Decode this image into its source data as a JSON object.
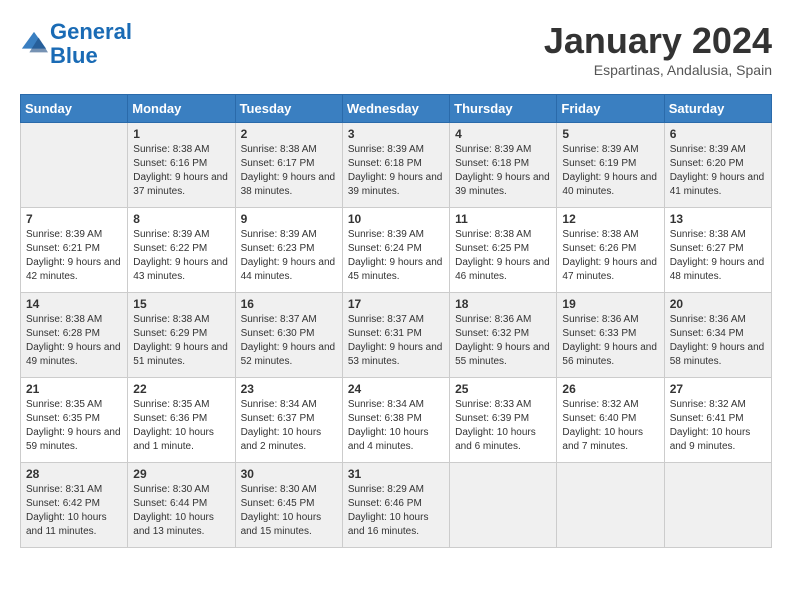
{
  "header": {
    "logo_line1": "General",
    "logo_line2": "Blue",
    "month_title": "January 2024",
    "subtitle": "Espartinas, Andalusia, Spain"
  },
  "days_of_week": [
    "Sunday",
    "Monday",
    "Tuesday",
    "Wednesday",
    "Thursday",
    "Friday",
    "Saturday"
  ],
  "weeks": [
    [
      {
        "day": "",
        "sunrise": "",
        "sunset": "",
        "daylight": ""
      },
      {
        "day": "1",
        "sunrise": "Sunrise: 8:38 AM",
        "sunset": "Sunset: 6:16 PM",
        "daylight": "Daylight: 9 hours and 37 minutes."
      },
      {
        "day": "2",
        "sunrise": "Sunrise: 8:38 AM",
        "sunset": "Sunset: 6:17 PM",
        "daylight": "Daylight: 9 hours and 38 minutes."
      },
      {
        "day": "3",
        "sunrise": "Sunrise: 8:39 AM",
        "sunset": "Sunset: 6:18 PM",
        "daylight": "Daylight: 9 hours and 39 minutes."
      },
      {
        "day": "4",
        "sunrise": "Sunrise: 8:39 AM",
        "sunset": "Sunset: 6:18 PM",
        "daylight": "Daylight: 9 hours and 39 minutes."
      },
      {
        "day": "5",
        "sunrise": "Sunrise: 8:39 AM",
        "sunset": "Sunset: 6:19 PM",
        "daylight": "Daylight: 9 hours and 40 minutes."
      },
      {
        "day": "6",
        "sunrise": "Sunrise: 8:39 AM",
        "sunset": "Sunset: 6:20 PM",
        "daylight": "Daylight: 9 hours and 41 minutes."
      }
    ],
    [
      {
        "day": "7",
        "sunrise": "Sunrise: 8:39 AM",
        "sunset": "Sunset: 6:21 PM",
        "daylight": "Daylight: 9 hours and 42 minutes."
      },
      {
        "day": "8",
        "sunrise": "Sunrise: 8:39 AM",
        "sunset": "Sunset: 6:22 PM",
        "daylight": "Daylight: 9 hours and 43 minutes."
      },
      {
        "day": "9",
        "sunrise": "Sunrise: 8:39 AM",
        "sunset": "Sunset: 6:23 PM",
        "daylight": "Daylight: 9 hours and 44 minutes."
      },
      {
        "day": "10",
        "sunrise": "Sunrise: 8:39 AM",
        "sunset": "Sunset: 6:24 PM",
        "daylight": "Daylight: 9 hours and 45 minutes."
      },
      {
        "day": "11",
        "sunrise": "Sunrise: 8:38 AM",
        "sunset": "Sunset: 6:25 PM",
        "daylight": "Daylight: 9 hours and 46 minutes."
      },
      {
        "day": "12",
        "sunrise": "Sunrise: 8:38 AM",
        "sunset": "Sunset: 6:26 PM",
        "daylight": "Daylight: 9 hours and 47 minutes."
      },
      {
        "day": "13",
        "sunrise": "Sunrise: 8:38 AM",
        "sunset": "Sunset: 6:27 PM",
        "daylight": "Daylight: 9 hours and 48 minutes."
      }
    ],
    [
      {
        "day": "14",
        "sunrise": "Sunrise: 8:38 AM",
        "sunset": "Sunset: 6:28 PM",
        "daylight": "Daylight: 9 hours and 49 minutes."
      },
      {
        "day": "15",
        "sunrise": "Sunrise: 8:38 AM",
        "sunset": "Sunset: 6:29 PM",
        "daylight": "Daylight: 9 hours and 51 minutes."
      },
      {
        "day": "16",
        "sunrise": "Sunrise: 8:37 AM",
        "sunset": "Sunset: 6:30 PM",
        "daylight": "Daylight: 9 hours and 52 minutes."
      },
      {
        "day": "17",
        "sunrise": "Sunrise: 8:37 AM",
        "sunset": "Sunset: 6:31 PM",
        "daylight": "Daylight: 9 hours and 53 minutes."
      },
      {
        "day": "18",
        "sunrise": "Sunrise: 8:36 AM",
        "sunset": "Sunset: 6:32 PM",
        "daylight": "Daylight: 9 hours and 55 minutes."
      },
      {
        "day": "19",
        "sunrise": "Sunrise: 8:36 AM",
        "sunset": "Sunset: 6:33 PM",
        "daylight": "Daylight: 9 hours and 56 minutes."
      },
      {
        "day": "20",
        "sunrise": "Sunrise: 8:36 AM",
        "sunset": "Sunset: 6:34 PM",
        "daylight": "Daylight: 9 hours and 58 minutes."
      }
    ],
    [
      {
        "day": "21",
        "sunrise": "Sunrise: 8:35 AM",
        "sunset": "Sunset: 6:35 PM",
        "daylight": "Daylight: 9 hours and 59 minutes."
      },
      {
        "day": "22",
        "sunrise": "Sunrise: 8:35 AM",
        "sunset": "Sunset: 6:36 PM",
        "daylight": "Daylight: 10 hours and 1 minute."
      },
      {
        "day": "23",
        "sunrise": "Sunrise: 8:34 AM",
        "sunset": "Sunset: 6:37 PM",
        "daylight": "Daylight: 10 hours and 2 minutes."
      },
      {
        "day": "24",
        "sunrise": "Sunrise: 8:34 AM",
        "sunset": "Sunset: 6:38 PM",
        "daylight": "Daylight: 10 hours and 4 minutes."
      },
      {
        "day": "25",
        "sunrise": "Sunrise: 8:33 AM",
        "sunset": "Sunset: 6:39 PM",
        "daylight": "Daylight: 10 hours and 6 minutes."
      },
      {
        "day": "26",
        "sunrise": "Sunrise: 8:32 AM",
        "sunset": "Sunset: 6:40 PM",
        "daylight": "Daylight: 10 hours and 7 minutes."
      },
      {
        "day": "27",
        "sunrise": "Sunrise: 8:32 AM",
        "sunset": "Sunset: 6:41 PM",
        "daylight": "Daylight: 10 hours and 9 minutes."
      }
    ],
    [
      {
        "day": "28",
        "sunrise": "Sunrise: 8:31 AM",
        "sunset": "Sunset: 6:42 PM",
        "daylight": "Daylight: 10 hours and 11 minutes."
      },
      {
        "day": "29",
        "sunrise": "Sunrise: 8:30 AM",
        "sunset": "Sunset: 6:44 PM",
        "daylight": "Daylight: 10 hours and 13 minutes."
      },
      {
        "day": "30",
        "sunrise": "Sunrise: 8:30 AM",
        "sunset": "Sunset: 6:45 PM",
        "daylight": "Daylight: 10 hours and 15 minutes."
      },
      {
        "day": "31",
        "sunrise": "Sunrise: 8:29 AM",
        "sunset": "Sunset: 6:46 PM",
        "daylight": "Daylight: 10 hours and 16 minutes."
      },
      {
        "day": "",
        "sunrise": "",
        "sunset": "",
        "daylight": ""
      },
      {
        "day": "",
        "sunrise": "",
        "sunset": "",
        "daylight": ""
      },
      {
        "day": "",
        "sunrise": "",
        "sunset": "",
        "daylight": ""
      }
    ]
  ]
}
